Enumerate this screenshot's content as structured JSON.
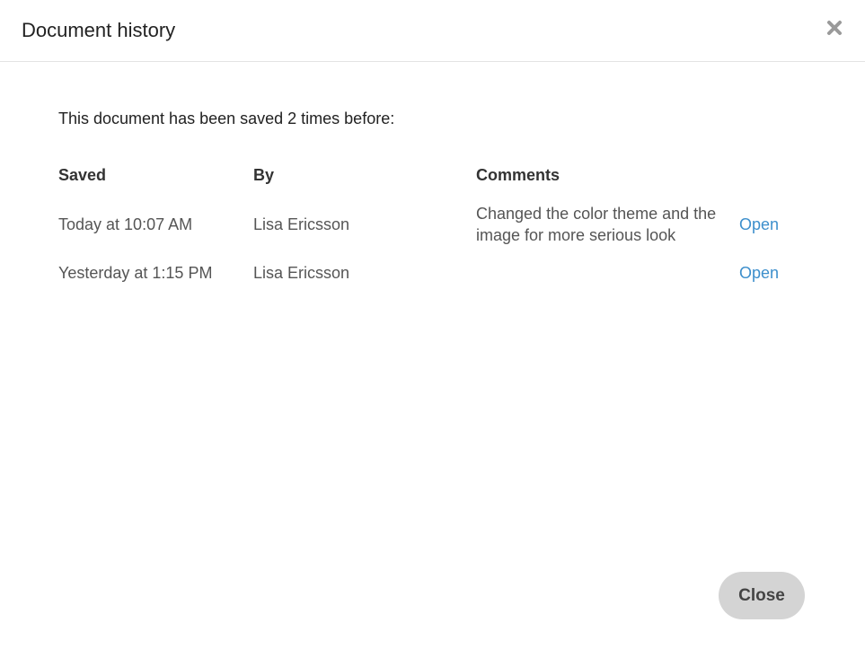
{
  "dialog": {
    "title": "Document history",
    "close_icon": "close-icon",
    "intro": "This document has been saved 2 times before:",
    "columns": {
      "saved": "Saved",
      "by": "By",
      "comments": "Comments"
    },
    "rows": [
      {
        "saved": "Today at 10:07 AM",
        "by": "Lisa Ericsson",
        "comment": "Changed the color theme and the image for more serious look",
        "action": "Open"
      },
      {
        "saved": "Yesterday at 1:15 PM",
        "by": "Lisa Ericsson",
        "comment": "",
        "action": "Open"
      }
    ],
    "close_button_label": "Close"
  },
  "colors": {
    "link": "#3d8fcc",
    "button_bg": "#d4d4d4",
    "divider": "#e3e3e3"
  }
}
